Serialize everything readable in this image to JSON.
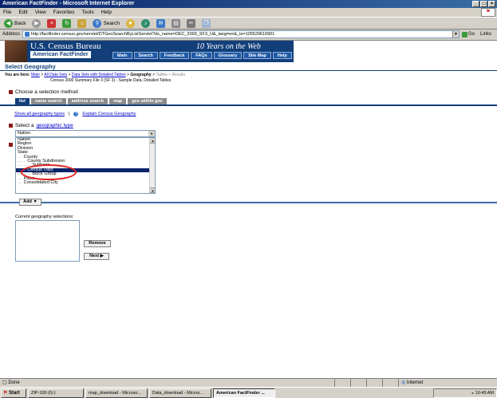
{
  "window": {
    "title": "American FactFinder - Microsoft Internet Explorer"
  },
  "menu": [
    "File",
    "Edit",
    "View",
    "Favorites",
    "Tools",
    "Help"
  ],
  "toolbar": {
    "back": "Back",
    "search": "Search"
  },
  "address": {
    "label": "Address",
    "url": "http://factfinder.census.gov/servlet/DTGeoSearchByListServlet?ds_name=DEC_2000_SF3_U&_lang=en&_ts=105529610901",
    "go": "Go",
    "links": "Links"
  },
  "banner": {
    "title": "U.S. Census Bureau",
    "subtitle": "American FactFinder",
    "tagline": "10 Years on the Web",
    "nav": [
      "Main",
      "Search",
      "Feedback",
      "FAQs",
      "Glossary",
      "Site Map",
      "Help"
    ]
  },
  "page": {
    "heading": "Select Geography",
    "crumbs_prefix": "You are here:",
    "crumbs": [
      "Main",
      "All Data Sets",
      "Data Sets with Detailed Tables"
    ],
    "crumb_current": "Geography",
    "crumb_rest": "Tables > Results",
    "dataset_line": "Census 2000 Summary File 3 (SF 3) - Sample Data, Detailed Tables",
    "choose_method": "Choose a selection method",
    "tabs": [
      "list",
      "name search",
      "address search",
      "map",
      "geo within geo"
    ],
    "show_all": "Show all geography types",
    "explain": "Explain Census Geography",
    "select_prefix": "Select a",
    "select_link": "geographic type",
    "dropdown_value": "Nation",
    "list_items": [
      "Nation",
      "Region",
      "Division",
      "State",
      "County",
      "County Subdivision",
      "Subbario",
      "Census Tract",
      "Block Group",
      "Place",
      "Consolidated City"
    ],
    "add_button": "Add",
    "current_label": "Current geography selections:",
    "remove_button": "Remove",
    "next_button": "Next"
  },
  "status": {
    "text": "Done",
    "zone": "Internet"
  },
  "taskbar": {
    "start": "Start",
    "items": [
      "ZIP-100 (G:)",
      "map_download - Microso...",
      "Data_download - Micros...",
      "American FactFinder ..."
    ],
    "clock": "10:49 AM"
  }
}
